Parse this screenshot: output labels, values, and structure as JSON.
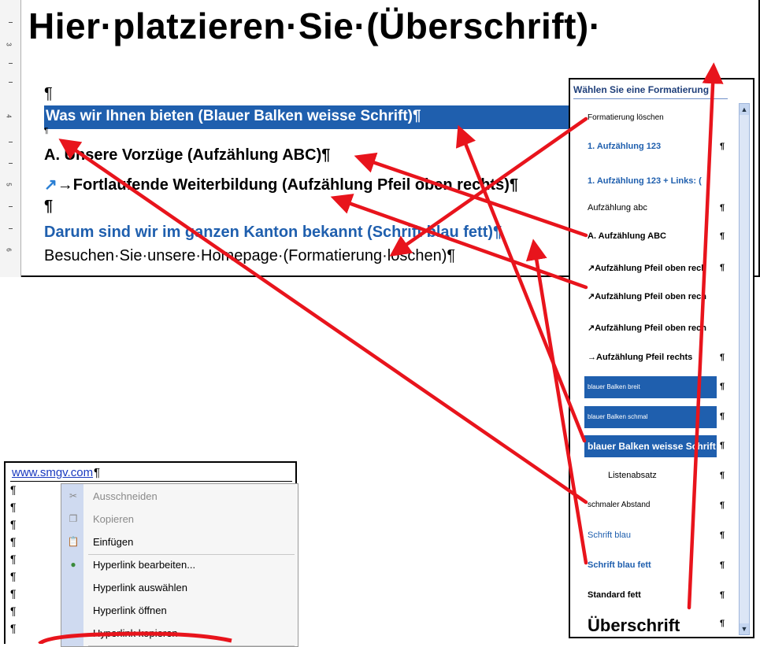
{
  "document": {
    "heading": "Hier·platzieren·Sie·(Überschrift)·",
    "pilcrow": "¶",
    "blue_bar_text": "Was wir Ihnen bieten (Blauer Balken weisse Schrift)¶",
    "small_pilcrow": "¶",
    "list_abc": "A. Unsere Vorzüge (Aufzählung ABC)¶",
    "arrow_glyph": "↗",
    "arrow_text": "→Fortlaufende Weiterbildung (Aufzählung Pfeil oben rechts)¶",
    "pilcrow2": "¶",
    "blue_bold": "Darum sind wir im ganzen Kanton bekannt (Schrift blau fett)¶",
    "homepage": "Besuchen·Sie·unsere·Homepage·(Formatierung·löschen)¶",
    "ruler_numbers": [
      "3",
      "4",
      "5",
      "6"
    ]
  },
  "styles_pane": {
    "title": "Wählen Sie eine Formatierung",
    "items": [
      {
        "label": "Formatierung löschen",
        "pilcrow": "",
        "color": "#000000",
        "bold": false,
        "bar": false
      },
      {
        "label": "1.  Aufzählung 123",
        "pilcrow": "¶",
        "color": "#1f5fae",
        "bold": true,
        "bar": false
      },
      {
        "label": "1.  Aufzählung 123 + Links: (",
        "pilcrow": "",
        "color": "#1f5fae",
        "bold": true,
        "bar": false
      },
      {
        "label": "Aufzählung abc",
        "pilcrow": "¶",
        "color": "#000000",
        "bold": false,
        "bar": false
      },
      {
        "label": "A.  Aufzählung ABC",
        "pilcrow": "¶",
        "color": "#000000",
        "bold": true,
        "bar": false
      },
      {
        "label": "↗Aufzählung Pfeil oben rech",
        "pilcrow": "¶",
        "color": "#000000",
        "bold": true,
        "bar": false
      },
      {
        "label": "↗Aufzählung Pfeil oben rech",
        "pilcrow": "",
        "color": "#000000",
        "bold": true,
        "bar": false
      },
      {
        "label": "↗Aufzählung Pfeil oben rech",
        "pilcrow": "",
        "color": "#000000",
        "bold": true,
        "bar": false
      },
      {
        "label": "→Aufzählung Pfeil rechts",
        "pilcrow": "¶",
        "color": "#000000",
        "bold": true,
        "bar": false
      },
      {
        "label": "blauer Balken breit",
        "pilcrow": "¶",
        "color": "#ffffff",
        "bold": false,
        "bar": true
      },
      {
        "label": "blauer Balken schmal",
        "pilcrow": "¶",
        "color": "#ffffff",
        "bold": false,
        "bar": true
      },
      {
        "label": "blauer Balken weisse Schrift",
        "pilcrow": "¶",
        "color": "#ffffff",
        "bold": true,
        "bar": true
      },
      {
        "label": "Listenabsatz",
        "pilcrow": "¶",
        "color": "#000000",
        "bold": false,
        "bar": false
      },
      {
        "label": "schmaler Abstand",
        "pilcrow": "¶",
        "color": "#000000",
        "bold": false,
        "bar": false
      },
      {
        "label": "Schrift blau",
        "pilcrow": "¶",
        "color": "#1f5fae",
        "bold": false,
        "bar": false
      },
      {
        "label": "Schrift blau fett",
        "pilcrow": "¶",
        "color": "#1f5fae",
        "bold": true,
        "bar": false
      },
      {
        "label": "Standard fett",
        "pilcrow": "¶",
        "color": "#000000",
        "bold": true,
        "bar": false
      },
      {
        "label": "Überschrift",
        "pilcrow": "¶",
        "color": "#000000",
        "bold": true,
        "bar": false
      }
    ]
  },
  "link_window": {
    "link_text": "www.smgv.com",
    "pilcrow": "¶",
    "context_menu": [
      {
        "label": "Ausschneiden",
        "disabled": true,
        "icon": "scissors-icon"
      },
      {
        "label": "Kopieren",
        "disabled": true,
        "icon": "copy-icon"
      },
      {
        "label": "Einfügen",
        "disabled": false,
        "icon": "paste-icon"
      },
      {
        "label": "Hyperlink bearbeiten...",
        "disabled": false,
        "icon": "globe-link-icon"
      },
      {
        "label": "Hyperlink auswählen",
        "disabled": false,
        "icon": ""
      },
      {
        "label": "Hyperlink öffnen",
        "disabled": false,
        "icon": ""
      },
      {
        "label": "Hyperlink kopieren",
        "disabled": false,
        "icon": ""
      }
    ]
  },
  "colors": {
    "annotation_red": "#e8141c",
    "bar_blue": "#1f5fae",
    "link_blue": "#1a3ac0"
  }
}
